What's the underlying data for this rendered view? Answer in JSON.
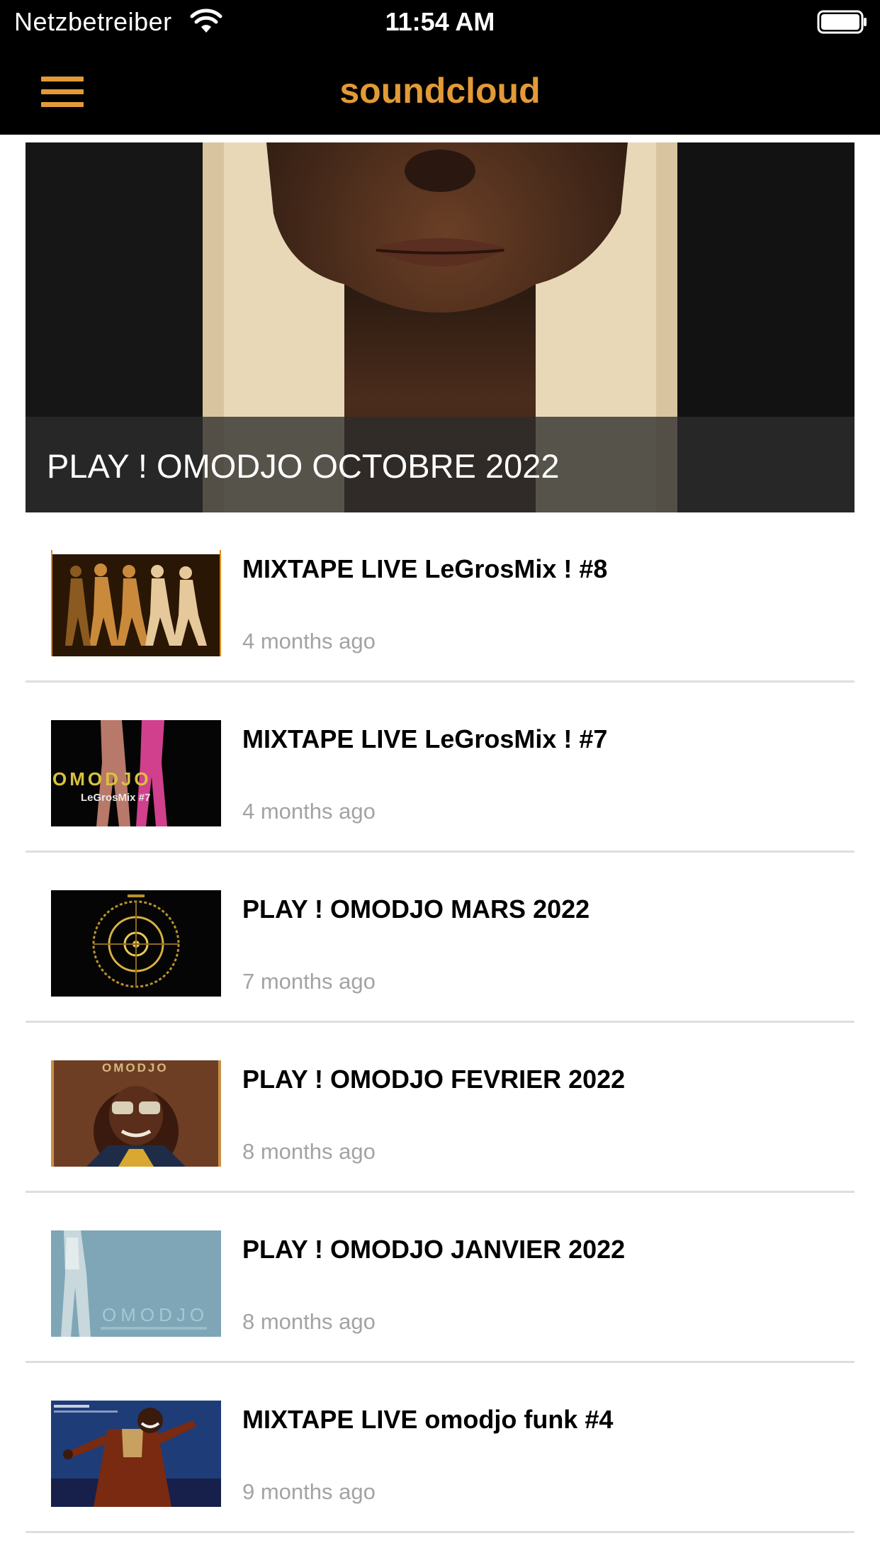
{
  "status_bar": {
    "carrier": "Netzbetreiber",
    "time": "11:54 AM"
  },
  "nav": {
    "title": "soundcloud",
    "accent_color": "#e39a36",
    "menu_icon": "hamburger-menu-icon"
  },
  "featured": {
    "title": "PLAY ! OMODJO OCTOBRE 2022"
  },
  "tracks": [
    {
      "title": "MIXTAPE LIVE LeGrosMix ! #8",
      "date": "4 months ago"
    },
    {
      "title": "MIXTAPE LIVE LeGrosMix ! #7",
      "date": "4 months ago",
      "artwork_text": "OMODJO",
      "artwork_subtext": "LeGrosMix #7"
    },
    {
      "title": "PLAY ! OMODJO MARS 2022",
      "date": "7 months ago"
    },
    {
      "title": "PLAY ! OMODJO FEVRIER 2022",
      "date": "8 months ago",
      "artwork_text": "OMODJO"
    },
    {
      "title": "PLAY ! OMODJO JANVIER 2022",
      "date": "8 months ago",
      "artwork_text": "OMODJO"
    },
    {
      "title": "MIXTAPE LIVE omodjo funk #4",
      "date": "9 months ago"
    }
  ]
}
